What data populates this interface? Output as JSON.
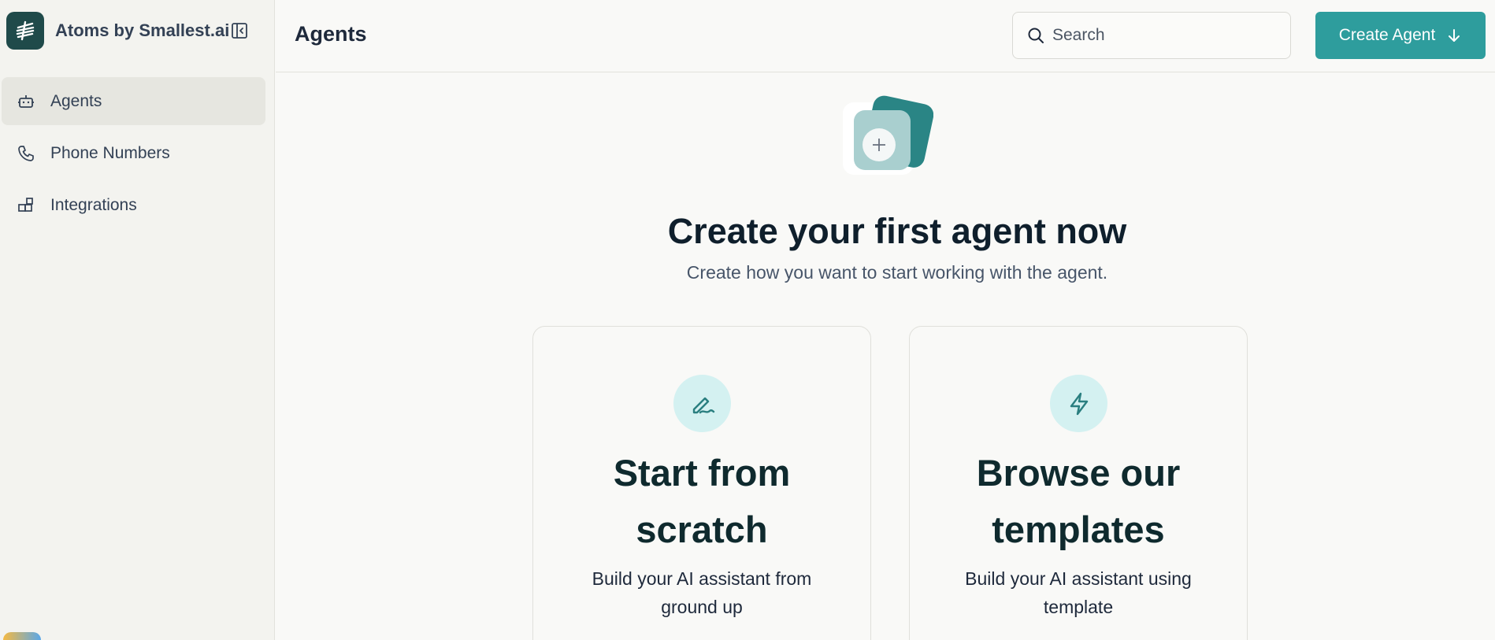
{
  "app": {
    "name": "Atoms by Smallest.ai"
  },
  "sidebar": {
    "items": [
      {
        "label": "Agents",
        "icon": "bot-icon",
        "active": true
      },
      {
        "label": "Phone Numbers",
        "icon": "phone-icon",
        "active": false
      },
      {
        "label": "Integrations",
        "icon": "integrations-icon",
        "active": false
      }
    ]
  },
  "header": {
    "title": "Agents",
    "search_placeholder": "Search",
    "create_label": "Create Agent"
  },
  "hero": {
    "title": "Create your first agent now",
    "subtitle": "Create how you want to start working with the agent."
  },
  "cards": [
    {
      "title": "Start from scratch",
      "description": "Build your AI assistant from ground up",
      "icon": "pen-icon"
    },
    {
      "title": "Browse our templates",
      "description": "Build your AI assistant using template",
      "icon": "lightning-icon"
    }
  ],
  "colors": {
    "accent": "#2e9d9d",
    "brand_dark": "#1f4a4a",
    "icon_bg": "#d4f1f1",
    "sidebar_bg": "#f3f3ef"
  }
}
